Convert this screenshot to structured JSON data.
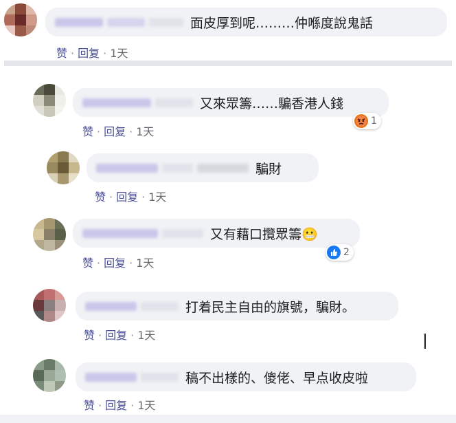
{
  "actions": {
    "like": "赞",
    "reply": "回复",
    "sep": "·"
  },
  "comments": [
    {
      "text": "面皮厚到呢………仲喺度說鬼話",
      "time": "1天",
      "avatar_colors": [
        "#c9a28a",
        "#8a4a3a",
        "#e0b8a8",
        "#b06a5a",
        "#6a2a2a",
        "#d09a8a",
        "#e8c8c0",
        "#9a5a4a",
        "#c08a7a"
      ]
    },
    {
      "text": "又來眾籌……騙香港人錢",
      "time": "1天",
      "reaction": {
        "type": "angry",
        "color": "#e9710f",
        "count": "1"
      },
      "avatar_colors": [
        "#6a6a58",
        "#4a4a3a",
        "#e8e8e0",
        "#d0d0c0",
        "#8a8a78",
        "#f0f0ea",
        "#e0e0d8",
        "#c8c8b8",
        "#f4f4ee"
      ]
    },
    {
      "text": "騙財",
      "time": "1天",
      "avatar_colors": [
        "#b0a070",
        "#8a7a50",
        "#e0d8c0",
        "#9a8a60",
        "#6a5a38",
        "#c8b890",
        "#d8d0b8",
        "#a89870",
        "#e8e0c8"
      ]
    },
    {
      "text": "又有藉口攬眾籌😬",
      "time": "1天",
      "reaction": {
        "type": "like",
        "color": "#1877f2",
        "count": "2"
      },
      "avatar_colors": [
        "#c8b890",
        "#a89870",
        "#6a7058",
        "#d8c8a0",
        "#8a8068",
        "#5a6048",
        "#b0a888",
        "#c0b8a0",
        "#9a9078"
      ]
    },
    {
      "text": "打着民主自由的旗號，騙財。",
      "time": "1天",
      "avatar_colors": [
        "#a85858",
        "#c07070",
        "#d89898",
        "#6a3a3a",
        "#8a8080",
        "#c8b0b0",
        "#5a5a5a",
        "#b08888",
        "#e0c8c8"
      ]
    },
    {
      "text": "稿不出樣的、傻佬、早点收皮啦",
      "time": "1天",
      "avatar_colors": [
        "#8a9a88",
        "#6a7a68",
        "#a8b8a8",
        "#5a6a58",
        "#9aa898",
        "#b0c0b0",
        "#7a8a78",
        "#c0c8b8",
        "#909a88"
      ]
    }
  ]
}
